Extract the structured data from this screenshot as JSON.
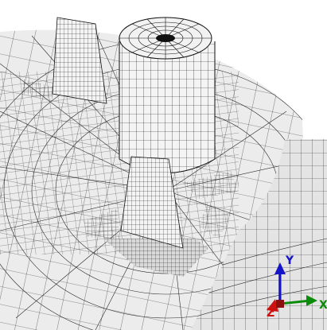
{
  "viewport": {
    "background": "#ffffff",
    "mesh_fill": "#ececec",
    "mesh_line": "#1a1a1a",
    "shade_fill": "#d9d9d9"
  },
  "triad": {
    "y_label": "Y",
    "z_label": "Z",
    "x_label": "X",
    "y_color": "#1414c8",
    "x_color": "#0a8c0a",
    "z_color": "#cc1111"
  }
}
